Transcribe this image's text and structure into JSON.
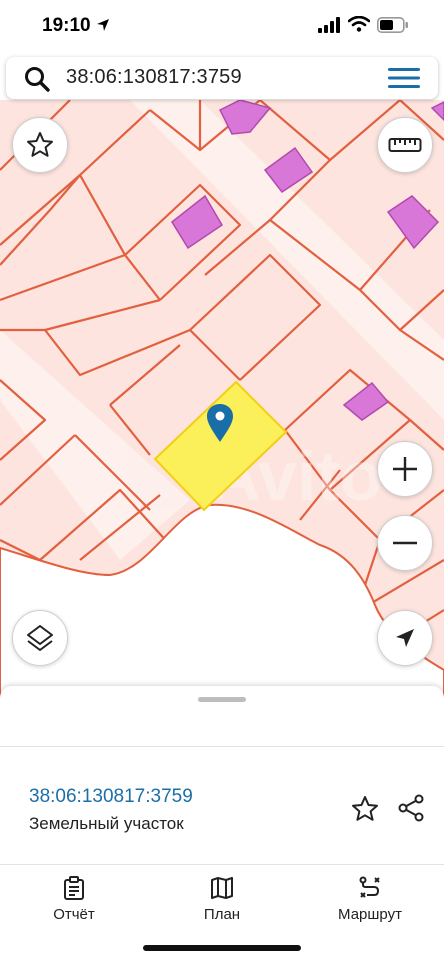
{
  "status_bar": {
    "time": "19:10"
  },
  "search": {
    "query": "38:06:130817:3759"
  },
  "map": {
    "watermark": "Avito",
    "colors": {
      "parcel_fill": "#fde4de",
      "parcel_border": "#e2603f",
      "building": "#dc6ed9",
      "selected": "#fbf05a"
    }
  },
  "map_buttons": {
    "favorite": "star-icon",
    "ruler": "ruler-icon",
    "zoom_in": "plus-icon",
    "zoom_out": "minus-icon",
    "layers": "layers-icon",
    "locate": "navigation-arrow-icon"
  },
  "sheet": {
    "parcel_number": "38:06:130817:3759",
    "parcel_type": "Земельный участок"
  },
  "tabs": [
    {
      "label": "Отчёт",
      "icon": "clipboard-icon"
    },
    {
      "label": "План",
      "icon": "map-icon"
    },
    {
      "label": "Маршрут",
      "icon": "route-icon"
    }
  ]
}
